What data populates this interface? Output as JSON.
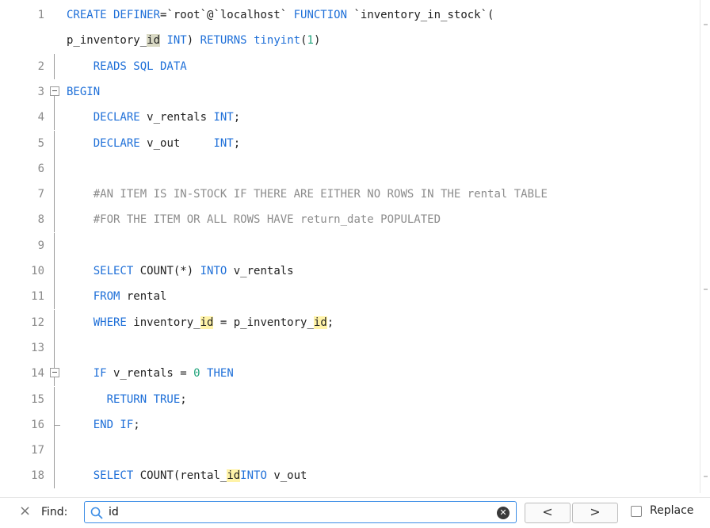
{
  "editor": {
    "lines": [
      {
        "n": "1",
        "segs": [
          [
            "kw",
            "CREATE DEFINER"
          ],
          [
            "",
            "=`root`@`localhost` "
          ],
          [
            "kw",
            "FUNCTION"
          ],
          [
            "",
            " `inventory_in_stock`("
          ]
        ]
      },
      {
        "n": "",
        "segs": [
          [
            "",
            "p_inventory_"
          ],
          [
            "hl-cur",
            "id"
          ],
          [
            "",
            " "
          ],
          [
            "kw",
            "INT"
          ],
          [
            "",
            ") "
          ],
          [
            "kw",
            "RETURNS"
          ],
          [
            "",
            " "
          ],
          [
            "kw",
            "tinyint"
          ],
          [
            "",
            "("
          ],
          [
            "num",
            "1"
          ],
          [
            "",
            ")"
          ]
        ]
      },
      {
        "n": "2",
        "segs": [
          [
            "",
            "    "
          ],
          [
            "kw",
            "READS SQL DATA"
          ]
        ]
      },
      {
        "n": "3",
        "segs": [
          [
            "kw",
            "BEGIN"
          ]
        ]
      },
      {
        "n": "4",
        "segs": [
          [
            "",
            "    "
          ],
          [
            "kw",
            "DECLARE"
          ],
          [
            "",
            " v_rentals "
          ],
          [
            "kw",
            "INT"
          ],
          [
            "",
            ";"
          ]
        ]
      },
      {
        "n": "5",
        "segs": [
          [
            "",
            "    "
          ],
          [
            "kw",
            "DECLARE"
          ],
          [
            "",
            " v_out     "
          ],
          [
            "kw",
            "INT"
          ],
          [
            "",
            ";"
          ]
        ]
      },
      {
        "n": "6",
        "segs": []
      },
      {
        "n": "7",
        "segs": [
          [
            "",
            "    "
          ],
          [
            "cmt",
            "#AN ITEM IS IN-STOCK IF THERE ARE EITHER NO ROWS IN THE rental TABLE"
          ]
        ]
      },
      {
        "n": "8",
        "segs": [
          [
            "",
            "    "
          ],
          [
            "cmt",
            "#FOR THE ITEM OR ALL ROWS HAVE return_date POPULATED"
          ]
        ]
      },
      {
        "n": "9",
        "segs": []
      },
      {
        "n": "10",
        "segs": [
          [
            "",
            "    "
          ],
          [
            "kw",
            "SELECT"
          ],
          [
            "",
            " COUNT(*) "
          ],
          [
            "kw",
            "INTO"
          ],
          [
            "",
            " v_rentals"
          ]
        ]
      },
      {
        "n": "11",
        "segs": [
          [
            "",
            "    "
          ],
          [
            "kw",
            "FROM"
          ],
          [
            "",
            " rental"
          ]
        ]
      },
      {
        "n": "12",
        "segs": [
          [
            "",
            "    "
          ],
          [
            "kw",
            "WHERE"
          ],
          [
            "",
            " inventory_"
          ],
          [
            "hl",
            "id"
          ],
          [
            "",
            " = p_inventory_"
          ],
          [
            "hl",
            "id"
          ],
          [
            "",
            ";"
          ]
        ]
      },
      {
        "n": "13",
        "segs": []
      },
      {
        "n": "14",
        "segs": [
          [
            "",
            "    "
          ],
          [
            "kw",
            "IF"
          ],
          [
            "",
            " v_rentals = "
          ],
          [
            "num",
            "0"
          ],
          [
            "",
            " "
          ],
          [
            "kw",
            "THEN"
          ]
        ]
      },
      {
        "n": "15",
        "segs": [
          [
            "",
            "      "
          ],
          [
            "kw",
            "RETURN TRUE"
          ],
          [
            "",
            ";"
          ]
        ]
      },
      {
        "n": "16",
        "segs": [
          [
            "",
            "    "
          ],
          [
            "kw",
            "END IF"
          ],
          [
            "",
            ";"
          ]
        ]
      },
      {
        "n": "17",
        "segs": []
      },
      {
        "n": "18",
        "segs": [
          [
            "",
            "    "
          ],
          [
            "kw",
            "SELECT"
          ],
          [
            "",
            " COUNT(rental_"
          ],
          [
            "hl",
            "id"
          ],
          [
            ") "
          ],
          [
            "kw",
            "INTO"
          ],
          [
            "",
            " v_out"
          ]
        ]
      }
    ]
  },
  "findbar": {
    "close_icon": "close-icon",
    "label": "Find:",
    "search_icon": "search-icon",
    "query": "id",
    "clear_icon": "clear-icon",
    "prev_label": "<",
    "next_label": ">",
    "replace_label": "Replace",
    "replace_checked": false
  },
  "colors": {
    "keyword": "#1e6fd8",
    "number": "#1fa37a",
    "comment": "#8c8c8c",
    "match_highlight": "#fff3a8",
    "current_match": "#d9d9c4",
    "focus_border": "#3d8ee6"
  }
}
